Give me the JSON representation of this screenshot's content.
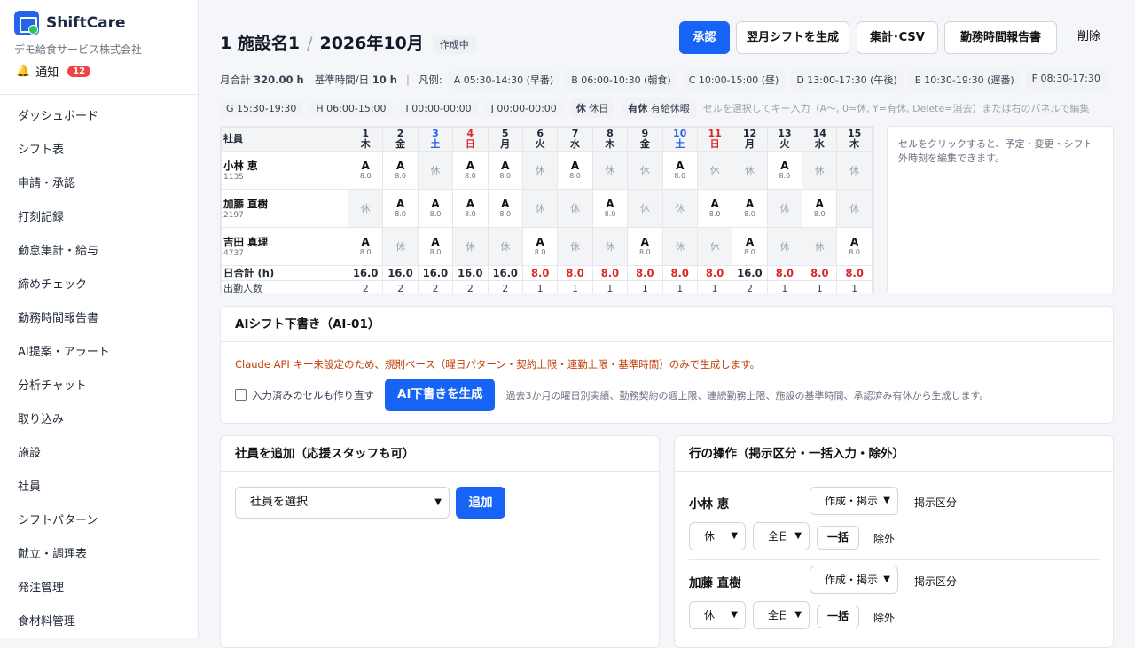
{
  "brand": {
    "name": "ShiftCare",
    "company": "デモ給食サービス株式会社",
    "notif_label": "通知",
    "notif_count": "12"
  },
  "nav": [
    "ダッシュボード",
    "シフト表",
    "申請・承認",
    "打刻記録",
    "勤怠集計・給与",
    "締めチェック",
    "勤務時間報告書",
    "AI提案・アラート",
    "分析チャット",
    "取り込み",
    "施設",
    "社員",
    "シフトパターン",
    "献立・調理表",
    "発注管理",
    "食材料管理"
  ],
  "header": {
    "facility": "1 施設名1",
    "sep": "/",
    "month": "2026年10月",
    "status": "作成中",
    "buttons": {
      "approve": "承認",
      "generate_next": "翌月シフトを生成",
      "csv": "集計･CSV",
      "report": "勤務時間報告書",
      "delete": "削除"
    }
  },
  "summary": {
    "monthly_label": "月合計",
    "monthly_value": "320.00 h",
    "base_label": "基準時間/日",
    "base_value": "10 h",
    "sep": "|",
    "legend_label": "凡例:",
    "patterns": [
      "A 05:30-14:30 (早番)",
      "B 06:00-10:30 (朝食)",
      "C 10:00-15:00 (昼)",
      "D 13:00-17:30 (午後)",
      "E 10:30-19:30 (遅番)",
      "F 08:30-17:30",
      "G 15:30-19:30",
      "H 06:00-15:00",
      "I 00:00-00:00",
      "J 00:00-00:00"
    ],
    "rest": {
      "key": "休",
      "label": "休日"
    },
    "paid": {
      "key": "有休",
      "label": "有給休暇"
    },
    "hint": "セルを選択してキー入力（A〜, 0=休, Y=有休, Delete=消去）または右のパネルで編集"
  },
  "grid": {
    "employee_header": "社員",
    "days": [
      {
        "d": "1",
        "w": "木"
      },
      {
        "d": "2",
        "w": "金"
      },
      {
        "d": "3",
        "w": "土"
      },
      {
        "d": "4",
        "w": "日"
      },
      {
        "d": "5",
        "w": "月"
      },
      {
        "d": "6",
        "w": "火"
      },
      {
        "d": "7",
        "w": "水"
      },
      {
        "d": "8",
        "w": "木"
      },
      {
        "d": "9",
        "w": "金"
      },
      {
        "d": "10",
        "w": "土"
      },
      {
        "d": "11",
        "w": "日"
      },
      {
        "d": "12",
        "w": "月"
      },
      {
        "d": "13",
        "w": "火"
      },
      {
        "d": "14",
        "w": "水"
      },
      {
        "d": "15",
        "w": "木"
      }
    ],
    "employees": [
      {
        "name": "小林 恵",
        "id": "1135",
        "cells": [
          "A",
          "A",
          "休",
          "A",
          "A",
          "休",
          "A",
          "休",
          "休",
          "A",
          "休",
          "休",
          "A",
          "休",
          "休"
        ]
      },
      {
        "name": "加藤 直樹",
        "id": "2197",
        "cells": [
          "休",
          "A",
          "A",
          "A",
          "A",
          "休",
          "休",
          "A",
          "休",
          "休",
          "A",
          "A",
          "休",
          "A",
          "休"
        ]
      },
      {
        "name": "吉田 真理",
        "id": "4737",
        "cells": [
          "A",
          "休",
          "A",
          "休",
          "休",
          "A",
          "休",
          "休",
          "A",
          "休",
          "休",
          "A",
          "休",
          "休",
          "A"
        ]
      }
    ],
    "hours_value": "8.0",
    "total_label": "日合計 (h)",
    "totals": [
      "16.0",
      "16.0",
      "16.0",
      "16.0",
      "16.0",
      "8.0",
      "8.0",
      "8.0",
      "8.0",
      "8.0",
      "8.0",
      "16.0",
      "8.0",
      "8.0",
      "8.0"
    ],
    "count_label": "出勤人数",
    "counts": [
      "2",
      "2",
      "2",
      "2",
      "2",
      "1",
      "1",
      "1",
      "1",
      "1",
      "1",
      "2",
      "1",
      "1",
      "1"
    ]
  },
  "side_panel": {
    "text": "セルをクリックすると、予定・変更・シフト外時刻を編集できます。"
  },
  "ai": {
    "title": "AIシフト下書き（AI-01）",
    "warning": "Claude API キー未設定のため、規則ベース（曜日パターン・契約上限・連勤上限・基準時間）のみで生成します。",
    "checkbox_label": "入力済みのセルも作り直す",
    "button": "AI下書きを生成",
    "desc": "過去3か月の曜日別実績、勤務契約の週上限、連続勤務上限、施設の基準時間、承認済み有休から生成します。"
  },
  "add_employee": {
    "title": "社員を追加（応援スタッフも可）",
    "select_value": "社員を選択",
    "button": "追加"
  },
  "row_ops": {
    "title": "行の操作（掲示区分・一括入力・除外）",
    "rows": [
      {
        "name": "小林 恵",
        "display": "作成・掲示",
        "display_label": "掲示区分",
        "shift": "休",
        "range": "全日",
        "bulk": "一括",
        "exclude": "除外"
      },
      {
        "name": "加藤 直樹",
        "display": "作成・掲示",
        "display_label": "掲示区分",
        "shift": "休",
        "range": "全日",
        "bulk": "一括",
        "exclude": "除外"
      }
    ]
  }
}
